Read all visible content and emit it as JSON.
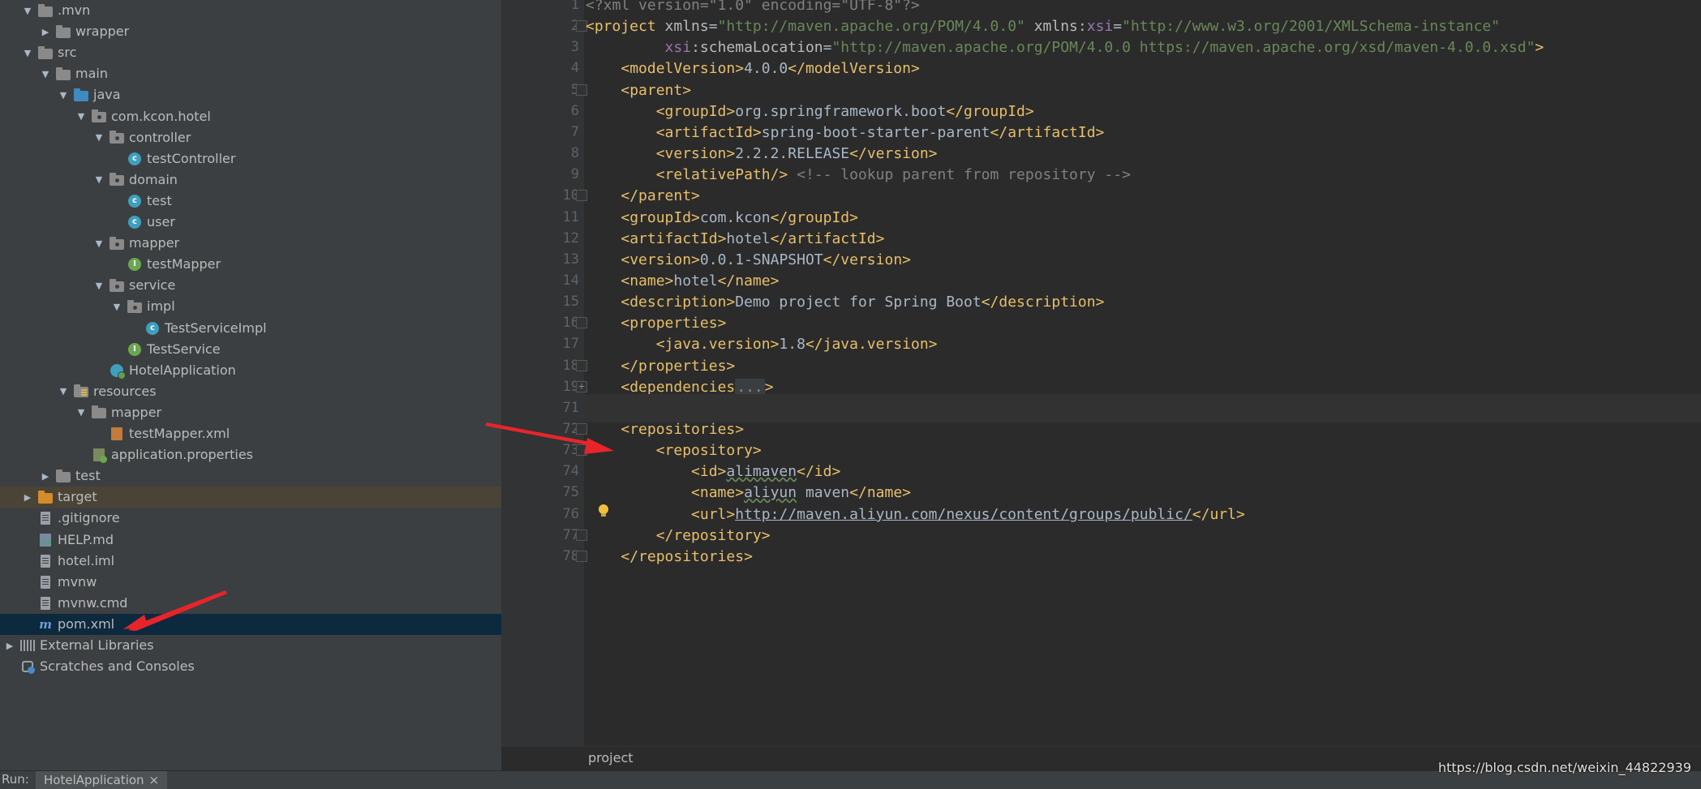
{
  "project_tree": {
    "items": [
      {
        "label": ".mvn",
        "depth": 1,
        "arrow": "down",
        "icon": "folder-icon"
      },
      {
        "label": "wrapper",
        "depth": 2,
        "arrow": "right",
        "icon": "folder-icon"
      },
      {
        "label": "src",
        "depth": 1,
        "arrow": "down",
        "icon": "folder-icon"
      },
      {
        "label": "main",
        "depth": 2,
        "arrow": "down",
        "icon": "folder-icon"
      },
      {
        "label": "java",
        "depth": 3,
        "arrow": "down",
        "icon": "source-folder-icon"
      },
      {
        "label": "com.kcon.hotel",
        "depth": 4,
        "arrow": "down",
        "icon": "package-icon"
      },
      {
        "label": "controller",
        "depth": 5,
        "arrow": "down",
        "icon": "package-icon"
      },
      {
        "label": "testController",
        "depth": 6,
        "arrow": "none",
        "icon": "class-icon"
      },
      {
        "label": "domain",
        "depth": 5,
        "arrow": "down",
        "icon": "package-icon"
      },
      {
        "label": "test",
        "depth": 6,
        "arrow": "none",
        "icon": "class-icon"
      },
      {
        "label": "user",
        "depth": 6,
        "arrow": "none",
        "icon": "class-icon"
      },
      {
        "label": "mapper",
        "depth": 5,
        "arrow": "down",
        "icon": "package-icon"
      },
      {
        "label": "testMapper",
        "depth": 6,
        "arrow": "none",
        "icon": "interface-icon"
      },
      {
        "label": "service",
        "depth": 5,
        "arrow": "down",
        "icon": "package-icon"
      },
      {
        "label": "impl",
        "depth": 6,
        "arrow": "down",
        "icon": "package-icon"
      },
      {
        "label": "TestServiceImpl",
        "depth": 7,
        "arrow": "none",
        "icon": "class-icon"
      },
      {
        "label": "TestService",
        "depth": 6,
        "arrow": "none",
        "icon": "interface-icon"
      },
      {
        "label": "HotelApplication",
        "depth": 5,
        "arrow": "none",
        "icon": "spring-app-icon"
      },
      {
        "label": "resources",
        "depth": 3,
        "arrow": "down",
        "icon": "resources-folder-icon"
      },
      {
        "label": "mapper",
        "depth": 4,
        "arrow": "down",
        "icon": "folder-icon"
      },
      {
        "label": "testMapper.xml",
        "depth": 5,
        "arrow": "none",
        "icon": "xml-file-icon"
      },
      {
        "label": "application.properties",
        "depth": 4,
        "arrow": "none",
        "icon": "properties-file-icon"
      },
      {
        "label": "test",
        "depth": 2,
        "arrow": "right",
        "icon": "folder-icon"
      },
      {
        "label": "target",
        "depth": 1,
        "arrow": "right",
        "icon": "excluded-folder-icon"
      },
      {
        "label": ".gitignore",
        "depth": 1,
        "arrow": "none",
        "icon": "file-icon"
      },
      {
        "label": "HELP.md",
        "depth": 1,
        "arrow": "none",
        "icon": "markdown-file-icon"
      },
      {
        "label": "hotel.iml",
        "depth": 1,
        "arrow": "none",
        "icon": "file-icon"
      },
      {
        "label": "mvnw",
        "depth": 1,
        "arrow": "none",
        "icon": "file-icon"
      },
      {
        "label": "mvnw.cmd",
        "depth": 1,
        "arrow": "none",
        "icon": "file-icon"
      },
      {
        "label": "pom.xml",
        "depth": 1,
        "arrow": "none",
        "icon": "maven-file-icon",
        "selected": true
      },
      {
        "label": "External Libraries",
        "depth": 0,
        "arrow": "right",
        "icon": "libraries-icon"
      },
      {
        "label": "Scratches and Consoles",
        "depth": 0,
        "arrow": "none",
        "icon": "scratches-icon"
      }
    ]
  },
  "editor": {
    "line_numbers": [
      "1",
      "2",
      "3",
      "4",
      "5",
      "6",
      "7",
      "8",
      "9",
      "10",
      "11",
      "12",
      "13",
      "14",
      "15",
      "16",
      "17",
      "18",
      "19",
      "71",
      "72",
      "73",
      "74",
      "75",
      "76",
      "77",
      "78"
    ],
    "lines": [
      [
        {
          "t": "<?xml version=\"1.0\" encoding=\"UTF-8\"?>",
          "c": "cmt"
        }
      ],
      [
        {
          "t": "<project ",
          "c": "tag"
        },
        {
          "t": "xmlns",
          "c": "attr"
        },
        {
          "t": "=",
          "c": "txt"
        },
        {
          "t": "\"http://maven.apache.org/POM/4.0.0\"",
          "c": "str"
        },
        {
          "t": " xmlns",
          "c": "attr"
        },
        {
          "t": ":",
          "c": "txt"
        },
        {
          "t": "xsi",
          "c": "ns"
        },
        {
          "t": "=",
          "c": "txt"
        },
        {
          "t": "\"http://www.w3.org/2001/XMLSchema-instance\"",
          "c": "str"
        }
      ],
      [
        {
          "t": "         ",
          "c": "txt"
        },
        {
          "t": "xsi",
          "c": "ns"
        },
        {
          "t": ":schemaLocation",
          "c": "attr"
        },
        {
          "t": "=",
          "c": "txt"
        },
        {
          "t": "\"http://maven.apache.org/POM/4.0.0 https://maven.apache.org/xsd/maven-4.0.0.xsd\"",
          "c": "str"
        },
        {
          "t": ">",
          "c": "tag"
        }
      ],
      [
        {
          "t": "    ",
          "c": "txt"
        },
        {
          "t": "<modelVersion>",
          "c": "tag"
        },
        {
          "t": "4.0.0",
          "c": "txt"
        },
        {
          "t": "</modelVersion>",
          "c": "tag"
        }
      ],
      [
        {
          "t": "    ",
          "c": "txt"
        },
        {
          "t": "<parent>",
          "c": "tag"
        }
      ],
      [
        {
          "t": "        ",
          "c": "txt"
        },
        {
          "t": "<groupId>",
          "c": "tag"
        },
        {
          "t": "org.springframework.boot",
          "c": "txt"
        },
        {
          "t": "</groupId>",
          "c": "tag"
        }
      ],
      [
        {
          "t": "        ",
          "c": "txt"
        },
        {
          "t": "<artifactId>",
          "c": "tag"
        },
        {
          "t": "spring-boot-starter-parent",
          "c": "txt"
        },
        {
          "t": "</artifactId>",
          "c": "tag"
        }
      ],
      [
        {
          "t": "        ",
          "c": "txt"
        },
        {
          "t": "<version>",
          "c": "tag"
        },
        {
          "t": "2.2.2.RELEASE",
          "c": "txt"
        },
        {
          "t": "</version>",
          "c": "tag"
        }
      ],
      [
        {
          "t": "        ",
          "c": "txt"
        },
        {
          "t": "<relativePath/>",
          "c": "tag"
        },
        {
          "t": " <!-- lookup parent from repository -->",
          "c": "cmt"
        }
      ],
      [
        {
          "t": "    ",
          "c": "txt"
        },
        {
          "t": "</parent>",
          "c": "tag"
        }
      ],
      [
        {
          "t": "    ",
          "c": "txt"
        },
        {
          "t": "<groupId>",
          "c": "tag"
        },
        {
          "t": "com.kcon",
          "c": "txt"
        },
        {
          "t": "</groupId>",
          "c": "tag"
        }
      ],
      [
        {
          "t": "    ",
          "c": "txt"
        },
        {
          "t": "<artifactId>",
          "c": "tag"
        },
        {
          "t": "hotel",
          "c": "txt"
        },
        {
          "t": "</artifactId>",
          "c": "tag"
        }
      ],
      [
        {
          "t": "    ",
          "c": "txt"
        },
        {
          "t": "<version>",
          "c": "tag"
        },
        {
          "t": "0.0.1-SNAPSHOT",
          "c": "txt"
        },
        {
          "t": "</version>",
          "c": "tag"
        }
      ],
      [
        {
          "t": "    ",
          "c": "txt"
        },
        {
          "t": "<name>",
          "c": "tag"
        },
        {
          "t": "hotel",
          "c": "txt"
        },
        {
          "t": "</name>",
          "c": "tag"
        }
      ],
      [
        {
          "t": "    ",
          "c": "txt"
        },
        {
          "t": "<description>",
          "c": "tag"
        },
        {
          "t": "Demo project for Spring Boot",
          "c": "txt"
        },
        {
          "t": "</description>",
          "c": "tag"
        }
      ],
      [
        {
          "t": "    ",
          "c": "txt"
        },
        {
          "t": "<properties>",
          "c": "tag"
        }
      ],
      [
        {
          "t": "        ",
          "c": "txt"
        },
        {
          "t": "<java.version>",
          "c": "tag"
        },
        {
          "t": "1.8",
          "c": "txt"
        },
        {
          "t": "</java.version>",
          "c": "tag"
        }
      ],
      [
        {
          "t": "    ",
          "c": "txt"
        },
        {
          "t": "</properties>",
          "c": "tag"
        }
      ],
      [
        {
          "t": "    ",
          "c": "txt"
        },
        {
          "t": "<dependencies",
          "c": "tag"
        },
        {
          "t": "...",
          "c": "folded"
        },
        {
          "t": ">",
          "c": "tag"
        }
      ],
      [],
      [
        {
          "t": "    ",
          "c": "txt"
        },
        {
          "t": "<repositories>",
          "c": "tag"
        }
      ],
      [
        {
          "t": "        ",
          "c": "txt"
        },
        {
          "t": "<repository>",
          "c": "tag"
        }
      ],
      [
        {
          "t": "            ",
          "c": "txt"
        },
        {
          "t": "<id>",
          "c": "tag"
        },
        {
          "t": "alimaven",
          "c": "squig"
        },
        {
          "t": "</id>",
          "c": "tag"
        }
      ],
      [
        {
          "t": "            ",
          "c": "txt"
        },
        {
          "t": "<name>",
          "c": "tag"
        },
        {
          "t": "aliyun",
          "c": "squig"
        },
        {
          "t": " maven",
          "c": "txt"
        },
        {
          "t": "</name>",
          "c": "tag"
        }
      ],
      [
        {
          "t": "            ",
          "c": "txt"
        },
        {
          "t": "<url>",
          "c": "tag"
        },
        {
          "t": "http://maven.aliyun.com/nexus/content/groups/public/",
          "c": "url"
        },
        {
          "t": "</url>",
          "c": "tag"
        }
      ],
      [
        {
          "t": "        ",
          "c": "txt"
        },
        {
          "t": "</repository>",
          "c": "tag"
        }
      ],
      [
        {
          "t": "    ",
          "c": "txt"
        },
        {
          "t": "</repositories>",
          "c": "tag"
        }
      ]
    ],
    "highlighted_line_index": 19
  },
  "breadcrumb": {
    "label": "project"
  },
  "run_bar": {
    "label": "Run:",
    "tab_label": "HotelApplication",
    "tab_close": "×"
  },
  "watermark": "https://blog.csdn.net/weixin_44822939",
  "colors": {
    "tree_bg": "#3c3f41",
    "editor_bg": "#2b2b2b",
    "tag": "#e8bf6a",
    "string": "#6a8759",
    "selection": "#0d293e",
    "arrow_annotation": "#e8242b"
  }
}
